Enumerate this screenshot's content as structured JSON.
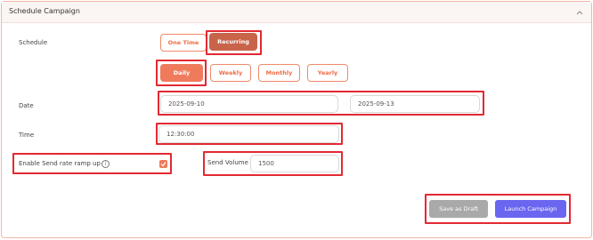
{
  "panel": {
    "title": "Schedule Campaign"
  },
  "schedule": {
    "label": "Schedule",
    "type_options": [
      "One Time",
      "Recurring"
    ],
    "selected_type": "Recurring",
    "frequency_options": [
      "Daily",
      "Weekly",
      "Monthly",
      "Yearly"
    ],
    "selected_frequency": "Daily"
  },
  "date": {
    "label": "Date",
    "start": "2025-09-10",
    "end": "2025-09-13"
  },
  "time": {
    "label": "Time",
    "value": "12:30:00"
  },
  "ramp": {
    "label": "Enable Send rate ramp up",
    "checked": true
  },
  "volume": {
    "label": "Send Volume",
    "value": "1500"
  },
  "actions": {
    "draft_label": "Save as Draft",
    "launch_label": "Launch Campaign"
  },
  "colors": {
    "accent": "#ef7a5c",
    "accent_dark": "#c8644a",
    "launch": "#6b66f0",
    "draft": "#a9a9a9",
    "highlight": "#e32932"
  }
}
